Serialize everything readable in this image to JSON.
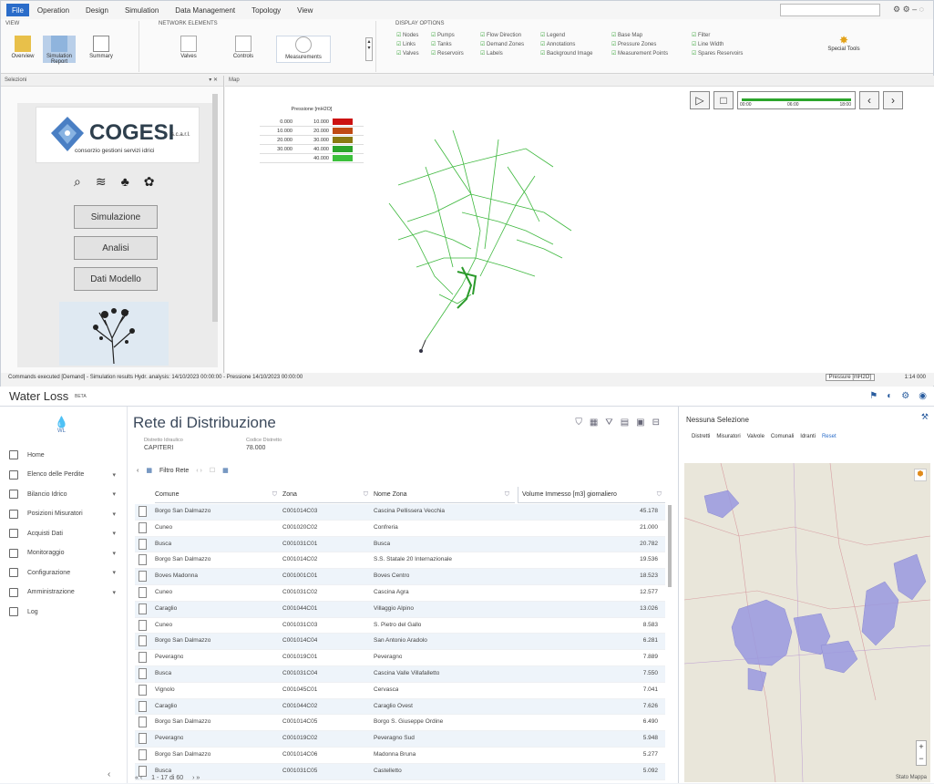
{
  "menu": {
    "file_label": "File",
    "items": [
      "Operation",
      "Design",
      "Simulation",
      "Data Management",
      "Topology",
      "View"
    ]
  },
  "ribbon": {
    "view_group_label": "VIEW",
    "view_tiles": [
      "Overview",
      "Simulation Report",
      "Summary"
    ],
    "network_group_label": "NETWORK ELEMENTS",
    "network_tiles": [
      "Valves",
      "Controls",
      "Measurements"
    ],
    "display_group_label": "DISPLAY OPTIONS",
    "display_options": [
      "Nodes",
      "Links",
      "Valves",
      "Pumps",
      "Tanks",
      "Reservoirs",
      "Flow Direction",
      "Demand Zones",
      "Labels",
      "Legend",
      "Annotations",
      "Background Image",
      "Base Map",
      "Pressure Zones",
      "Measurement Points",
      "Filter",
      "Line Width",
      "Spares Reservoirs"
    ],
    "tool_label": "Special Tools"
  },
  "left_panel": {
    "title": "Selezioni",
    "logo_text": "COGESI",
    "logo_suffix": "s.c.a.r.l.",
    "logo_subtitle": "consorzio gestioni servizi idrici",
    "buttons": [
      "Simulazione",
      "Analisi",
      "Dati Modello"
    ]
  },
  "map": {
    "title": "Map",
    "legend_title": "Pressione [mH2O]",
    "legend_rows": [
      {
        "from": "0.000",
        "to": "10.000",
        "color": "#cc1111"
      },
      {
        "from": "10.000",
        "to": "20.000",
        "color": "#c04a14"
      },
      {
        "from": "20.000",
        "to": "30.000",
        "color": "#8a7a12"
      },
      {
        "from": "30.000",
        "to": "40.000",
        "color": "#2ca52c"
      },
      {
        "from": "",
        "to": "40.000",
        "color": "#3cc03c"
      }
    ],
    "timeline_labels": [
      "00:00",
      "06:00",
      "18:00"
    ]
  },
  "status": {
    "text": "Commands executed [Demand] - Simulation results Hydr. analysis: 14/10/2023 00:00:00 - Pressione 14/10/2023 00:00:00",
    "right1": "Pressure [mH2O]",
    "right2": "1:14 000"
  },
  "app": {
    "title": "Water Loss",
    "badge": "BETA"
  },
  "sidebar": {
    "logo_label": "WL",
    "items": [
      "Home",
      "Elenco delle Perdite",
      "Bilancio Idrico",
      "Posizioni Misuratori",
      "Acquisti Dati",
      "Monitoraggio",
      "Configurazione",
      "Amministrazione",
      "Log"
    ]
  },
  "main": {
    "title": "Rete di Distribuzione",
    "field1_label": "Distretto Idraulico",
    "field1_value": "CAPITERI",
    "field2_label": "Codice Distretto",
    "field2_value": "78.000",
    "toolbar_label": "Filtro Rete",
    "columns": [
      "Comune",
      "Zona",
      "Nome Zona",
      "Volume Immesso [m3] giornaliero"
    ],
    "rows": [
      [
        "Borgo San Dalmazzo",
        "C001014C03",
        "Cascina Pellissera Vecchia",
        "45.178"
      ],
      [
        "Cuneo",
        "C001020C02",
        "Confreria",
        "21.000"
      ],
      [
        "Busca",
        "C001031C01",
        "Busca",
        "20.782"
      ],
      [
        "Borgo San Dalmazzo",
        "C001014C02",
        "S.S. Statale 20 Internazionale",
        "19.536"
      ],
      [
        "Boves Madonna",
        "C001001C01",
        "Boves Centro",
        "18.523"
      ],
      [
        "Cuneo",
        "C001031C02",
        "Cascina Agra",
        "12.577"
      ],
      [
        "Caraglio",
        "C001044C01",
        "Villaggio Alpino",
        "13.026"
      ],
      [
        "Cuneo",
        "C001031C03",
        "S. Pietro del Gallo",
        "8.583"
      ],
      [
        "Borgo San Dalmazzo",
        "C001014C04",
        "San Antonio Aradolo",
        "6.281"
      ],
      [
        "Peveragno",
        "C001019C01",
        "Peveragno",
        "7.889"
      ],
      [
        "Busca",
        "C001031C04",
        "Cascina Valle Villafalletto",
        "7.550"
      ],
      [
        "Vignolo",
        "C001045C01",
        "Cervasca",
        "7.041"
      ],
      [
        "Caraglio",
        "C001044C02",
        "Caraglio Ovest",
        "7.626"
      ],
      [
        "Borgo San Dalmazzo",
        "C001014C05",
        "Borgo S. Giuseppe Ordine",
        "6.490"
      ],
      [
        "Peveragno",
        "C001019C02",
        "Peveragno Sud",
        "5.948"
      ],
      [
        "Borgo San Dalmazzo",
        "C001014C06",
        "Madonna Bruna",
        "5.277"
      ],
      [
        "Busca",
        "C001031C05",
        "Castelletto",
        "5.092"
      ]
    ],
    "pager_text": "1 - 17 di 60"
  },
  "right_panel": {
    "title": "Nessuna Selezione",
    "tabs": [
      "Distretti",
      "Misuratori",
      "Valvole",
      "Comunali",
      "Idranti",
      "Reset"
    ],
    "map_label": "Stato Mappa"
  }
}
